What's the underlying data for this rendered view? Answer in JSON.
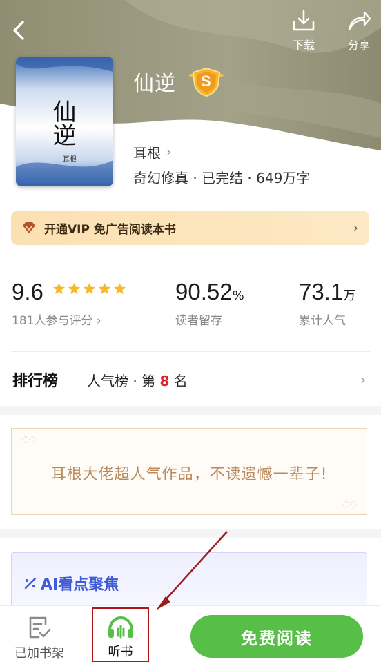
{
  "header": {
    "download_label": "下载",
    "share_label": "分享"
  },
  "book": {
    "title": "仙逆",
    "badge_letter": "S",
    "author": "耳根",
    "meta": "奇幻修真 · 已完结 · 649万字",
    "cover_title": "仙逆",
    "cover_author": "耳根"
  },
  "vip": {
    "label": "开通VIP 免广告阅读本书"
  },
  "stats": {
    "rating": "9.6",
    "rating_stars": 5,
    "rating_sub": "181人参与评分 ›",
    "retention": "90.52",
    "retention_unit": "%",
    "retention_sub": "读者留存",
    "popularity": "73.1",
    "popularity_unit": "万",
    "popularity_sub": "累计人气"
  },
  "ranking": {
    "title": "排行榜",
    "text_prefix": "人气榜 · 第 ",
    "rank": "8",
    "text_suffix": " 名"
  },
  "quote": {
    "text": "耳根大佬超人气作品，不读遗憾一辈子!"
  },
  "ai": {
    "title": "AI看点聚焦"
  },
  "bottom": {
    "shelf_label": "已加书架",
    "listen_label": "听书",
    "read_label": "免费阅读"
  },
  "colors": {
    "accent_green": "#57be47",
    "rank_red": "#d9242b",
    "hero_olive": "#9b9a80",
    "highlight_box": "#b01212"
  }
}
